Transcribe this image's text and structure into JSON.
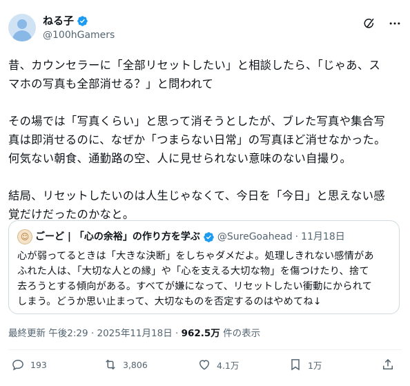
{
  "author": {
    "display_name": "ねる子",
    "handle": "@100hGamers"
  },
  "header_icons": [
    "grok-icon",
    "more-icon"
  ],
  "tweet": {
    "text": "昔、カウンセラーに「全部リセットしたい」と相談したら、「じゃあ、ス\nマホの写真も全部消せる？」と問われて\n\nその場では「写真くらい」と思って消そうとしたが、ブレた写真や集合写\n真は即消せるのに、なぜか「つまらない日常」の写真ほど消せなかった。\n何気ない朝食、通勤路の空、人に見せられない意味のない自撮り。\n\n結局、リセットしたいのは人生じゃなくて、今日を「今日」と思えない感\n覚だけだったのかなと。"
  },
  "quote": {
    "name": "ごーど | 「心の余裕」の作り方を学ぶ",
    "handle": "@SureGoahead",
    "separator": "·",
    "date": "11月18日",
    "text": "心が弱ってるときは「大きな決断」をしちゃダメだよ。処理しきれない感情があ\nふれた人は、「大切な人との縁」や「心を支える大切な物」を傷つけたり、捨て\n去ろうとする傾向がある。すべてが嫌になって、リセットしたい衝動にかられて\nしまう。どうか思い止まって、大切なものを否定するのはやめてね↓"
  },
  "meta": {
    "prefix": "最終更新 午後2:29 · 2025年11月18日 · ",
    "views": "962.5万",
    "suffix": " 件の表示"
  },
  "actions": {
    "replies": "193",
    "reposts": "3,806",
    "likes": "4.1万",
    "bookmarks": "1万"
  },
  "colors": {
    "verified": "#1d9bf0",
    "secondary_text": "#536471",
    "border": "#cfd9de"
  }
}
